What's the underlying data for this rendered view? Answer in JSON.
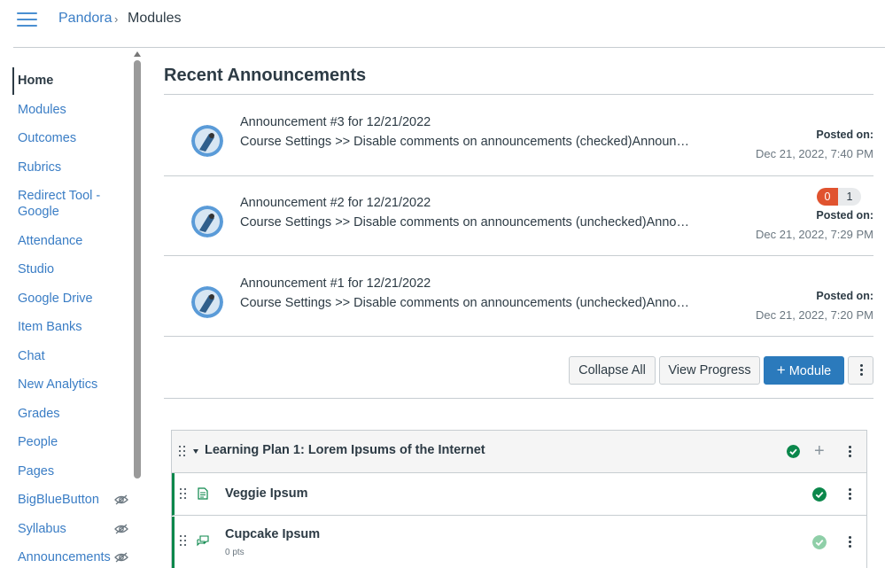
{
  "breadcrumb": {
    "course": "Pandora",
    "separator": "›",
    "current": "Modules"
  },
  "sidebar": {
    "items": [
      {
        "label": "Home",
        "active": true,
        "hidden": false
      },
      {
        "label": "Modules",
        "active": false,
        "hidden": false
      },
      {
        "label": "Outcomes",
        "active": false,
        "hidden": false
      },
      {
        "label": "Rubrics",
        "active": false,
        "hidden": false
      },
      {
        "label": "Redirect Tool - Google",
        "active": false,
        "hidden": false
      },
      {
        "label": "Attendance",
        "active": false,
        "hidden": false
      },
      {
        "label": "Studio",
        "active": false,
        "hidden": false
      },
      {
        "label": "Google Drive",
        "active": false,
        "hidden": false
      },
      {
        "label": "Item Banks",
        "active": false,
        "hidden": false
      },
      {
        "label": "Chat",
        "active": false,
        "hidden": false
      },
      {
        "label": "New Analytics",
        "active": false,
        "hidden": false
      },
      {
        "label": "Grades",
        "active": false,
        "hidden": false
      },
      {
        "label": "People",
        "active": false,
        "hidden": false
      },
      {
        "label": "Pages",
        "active": false,
        "hidden": false
      },
      {
        "label": "BigBlueButton",
        "active": false,
        "hidden": true
      },
      {
        "label": "Syllabus",
        "active": false,
        "hidden": true
      },
      {
        "label": "Announcements",
        "active": false,
        "hidden": true
      }
    ]
  },
  "announcements": {
    "title": "Recent Announcements",
    "posted_label": "Posted on:",
    "items": [
      {
        "title": "Announcement #3 for 12/21/2022",
        "body": "Course Settings >> Disable comments on announcements (checked)Announcements",
        "date": "Dec 21, 2022, 7:40 PM",
        "badges": null
      },
      {
        "title": "Announcement #2 for 12/21/2022",
        "body": "Course Settings >> Disable comments on announcements (unchecked)Announcements",
        "date": "Dec 21, 2022, 7:29 PM",
        "badges": {
          "unread": "0",
          "total": "1"
        }
      },
      {
        "title": "Announcement #1 for 12/21/2022",
        "body": "Course Settings >> Disable comments on announcements (unchecked)Announcements",
        "date": "Dec 21, 2022, 7:20 PM",
        "badges": null
      }
    ]
  },
  "toolbar": {
    "collapse_all": "Collapse All",
    "view_progress": "View Progress",
    "add_module": "Module",
    "add_symbol": "+"
  },
  "module": {
    "title": "Learning Plan 1: Lorem Ipsums of the Internet",
    "items": [
      {
        "title": "Veggie Ipsum",
        "type": "page",
        "subtitle": "",
        "status": "complete"
      },
      {
        "title": "Cupcake Ipsum",
        "type": "discussion",
        "subtitle": "0 pts",
        "status": "complete-light"
      }
    ]
  },
  "colors": {
    "link": "#3a7dc5",
    "primary": "#2b7abc",
    "success": "#0b874b",
    "badge": "#e0532f"
  }
}
